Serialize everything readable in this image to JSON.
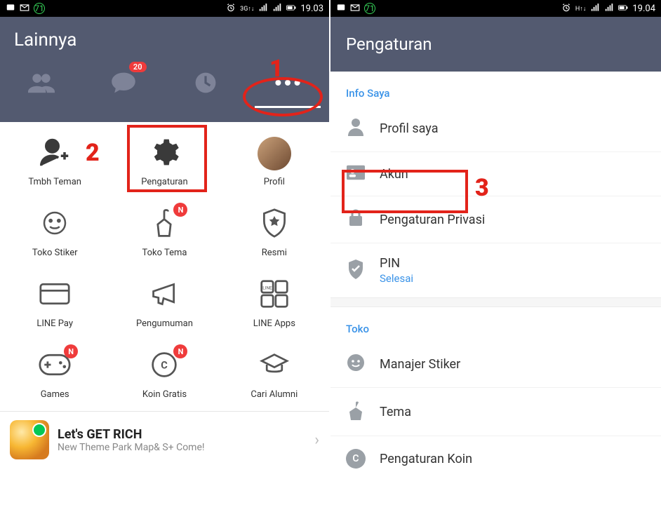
{
  "left": {
    "status": {
      "time": "19.03",
      "battery_glyph": "71"
    },
    "header_title": "Lainnya",
    "chat_badge": "20",
    "grid": [
      {
        "label": "Tmbh Teman",
        "icon": "add-friend-icon"
      },
      {
        "label": "Pengaturan",
        "icon": "gear-icon"
      },
      {
        "label": "Profil",
        "icon": "avatar-icon"
      },
      {
        "label": "Toko Stiker",
        "icon": "sticker-shop-icon"
      },
      {
        "label": "Toko Tema",
        "icon": "theme-shop-icon",
        "badge": "N"
      },
      {
        "label": "Resmi",
        "icon": "official-icon"
      },
      {
        "label": "LINE Pay",
        "icon": "line-pay-icon"
      },
      {
        "label": "Pengumuman",
        "icon": "megaphone-icon"
      },
      {
        "label": "LINE Apps",
        "icon": "line-apps-icon"
      },
      {
        "label": "Games",
        "icon": "gamepad-icon",
        "badge": "N"
      },
      {
        "label": "Koin Gratis",
        "icon": "free-coin-icon",
        "badge": "N"
      },
      {
        "label": "Cari Alumni",
        "icon": "alumni-icon"
      }
    ],
    "promo": {
      "title": "Let's GET RICH",
      "subtitle": "New Theme Park Map& S+ Come!"
    },
    "anno": {
      "n1": "1",
      "n2": "2"
    }
  },
  "right": {
    "status": {
      "time": "19.04",
      "battery_glyph": "71"
    },
    "header_title": "Pengaturan",
    "section1_label": "Info Saya",
    "section1_items": [
      {
        "label": "Profil saya",
        "icon": "person-icon"
      },
      {
        "label": "Akun",
        "icon": "id-card-icon"
      },
      {
        "label": "Pengaturan Privasi",
        "icon": "lock-icon"
      },
      {
        "label": "PIN",
        "sub": "Selesai",
        "icon": "shield-check-icon"
      }
    ],
    "section2_label": "Toko",
    "section2_items": [
      {
        "label": "Manajer Stiker",
        "icon": "smiley-icon"
      },
      {
        "label": "Tema",
        "icon": "brush-icon"
      },
      {
        "label": "Pengaturan Koin",
        "icon": "coin-c-icon"
      }
    ],
    "anno": {
      "n3": "3"
    }
  }
}
